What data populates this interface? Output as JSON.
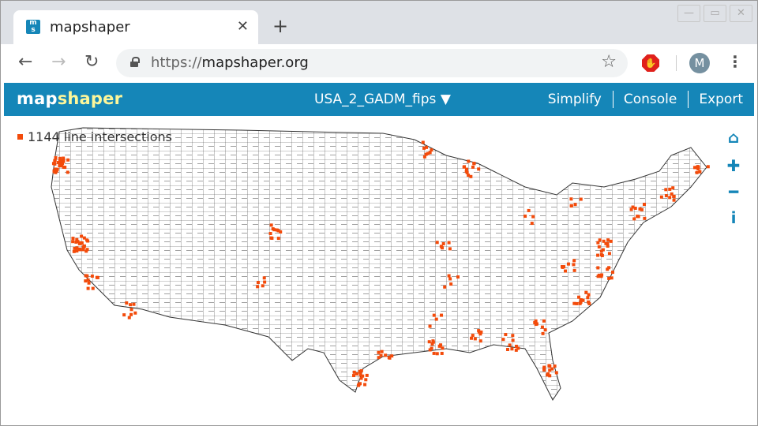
{
  "browser": {
    "tab_title": "mapshaper",
    "url_scheme": "https://",
    "url_host": "mapshaper.org",
    "avatar_initial": "M"
  },
  "app": {
    "logo_a": "map",
    "logo_b": "shaper",
    "layer_name": "USA_2_GADM_fips",
    "layer_arrow": "▼",
    "menu": [
      "Simplify",
      "Console",
      "Export"
    ],
    "intersections_label": "1144 line intersections"
  },
  "colors": {
    "accent": "#1586b8",
    "intersection": "#f34b0b",
    "logo_highlight": "#fdf69a"
  }
}
